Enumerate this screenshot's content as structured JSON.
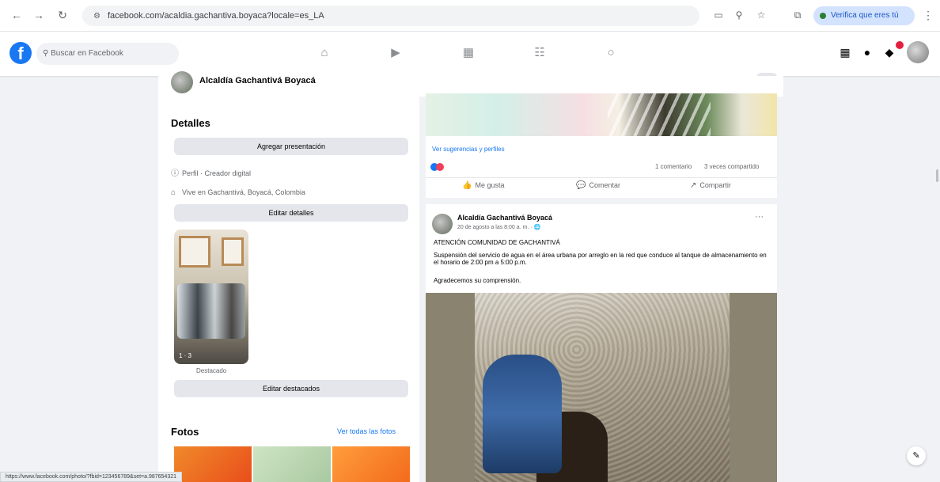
{
  "browser": {
    "url": "facebook.com/acaldia.gachantiva.boyaca?locale=es_LA",
    "profile_chip": "Verifica que eres tú"
  },
  "fb_nav": {
    "search_placeholder": "Buscar en Facebook"
  },
  "profile": {
    "name": "Alcaldía Gachantivá Boyacá"
  },
  "details": {
    "title": "Detalles",
    "add_presentation": "Agregar presentación",
    "page_type": "Perfil · Creador digital",
    "location": "Vive en Gachantivá, Boyacá, Colombia",
    "edit_details": "Editar detalles",
    "featured_label": "Destacado",
    "featured_count": "1 · 3",
    "edit_featured": "Editar destacados"
  },
  "photos": {
    "title": "Fotos",
    "see_all": "Ver todas las fotos"
  },
  "feed_top": {
    "link_text": "Ver sugerencias y perfiles",
    "comments": "1 comentario",
    "shares": "3 veces compartido",
    "like": "Me gusta",
    "comment": "Comentar",
    "share": "Compartir"
  },
  "post": {
    "author": "Alcaldía Gachantivá Boyacá",
    "time": "20 de agosto a las 8:00 a. m. · 🌐",
    "line1": "ATENCIÓN COMUNIDAD DE GACHANTIVÁ",
    "line2": "Suspensión del servicio de agua en el área urbana por arreglo en la red que conduce al tanque de almacenamiento en el horario de 2:00 pm a 5:00 p.m.",
    "line3": "Agradecemos su comprensión."
  },
  "status_bar": {
    "url": "https://www.facebook.com/photo/?fbid=123456789&set=a.987654321"
  }
}
